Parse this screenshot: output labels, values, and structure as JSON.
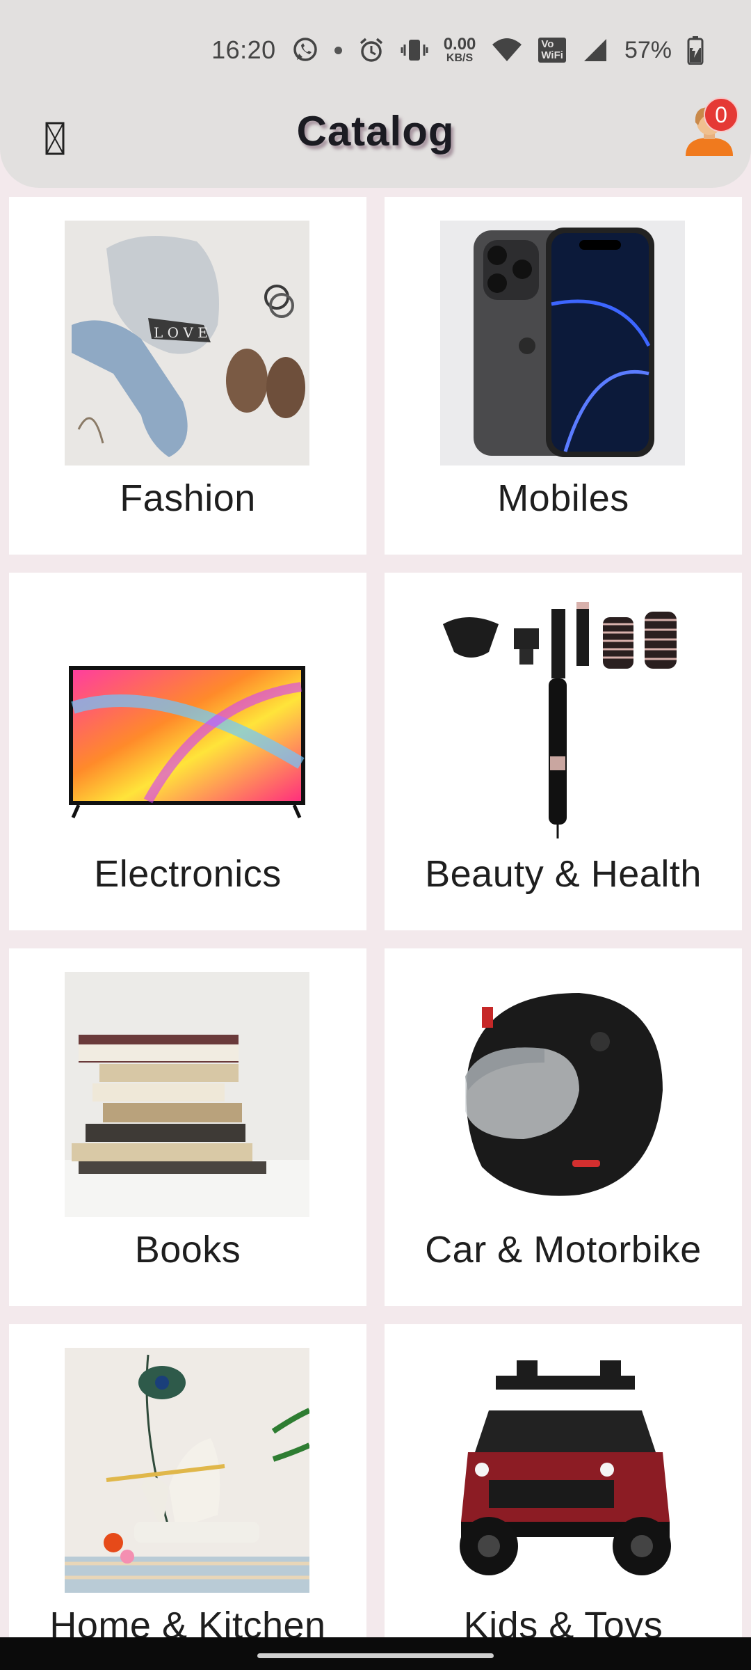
{
  "status_bar": {
    "time": "16:20",
    "net_speed_value": "0.00",
    "net_speed_unit": "KB/S",
    "vowifi_top": "Vo",
    "vowifi_bottom": "WiFi",
    "battery": "57%",
    "icons": [
      "whatsapp-icon",
      "dot-icon",
      "alarm-icon",
      "vibrate-icon",
      "wifi-icon",
      "signal-icon",
      "battery-charging-icon"
    ]
  },
  "app_bar": {
    "menu_icon": "menu-icon",
    "title": "Catalog",
    "cart_icon": "person-avatar-icon",
    "cart_count": "0"
  },
  "categories": [
    {
      "label": "Fashion",
      "image": "fashion-image"
    },
    {
      "label": "Mobiles",
      "image": "smartphone-image"
    },
    {
      "label": "Electronics",
      "image": "television-image"
    },
    {
      "label": "Beauty & Health",
      "image": "hair-styler-image"
    },
    {
      "label": "Books",
      "image": "book-stack-image"
    },
    {
      "label": "Car & Motorbike",
      "image": "helmet-image"
    },
    {
      "label": "Home & Kitchen",
      "image": "decor-hands-image"
    },
    {
      "label": "Kids & Toys",
      "image": "toy-jeep-image"
    }
  ],
  "colors": {
    "background": "#f3e9ec",
    "app_bar": "#e2e0df",
    "card": "#ffffff",
    "badge": "#e53935"
  }
}
